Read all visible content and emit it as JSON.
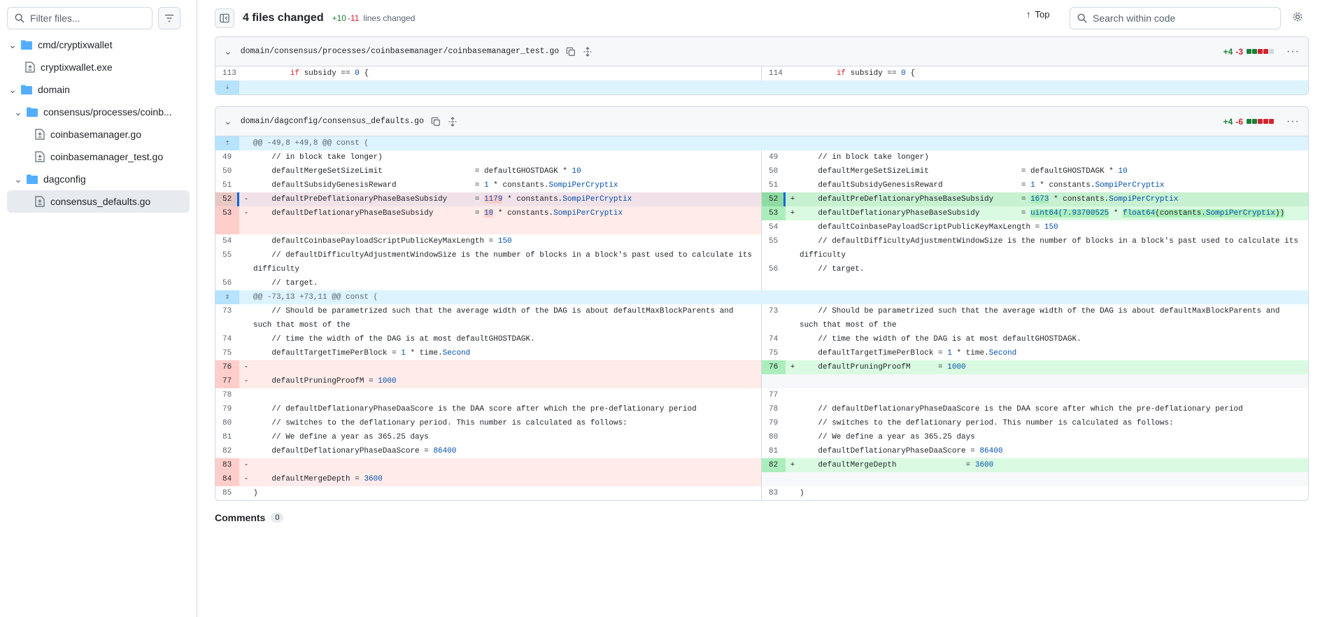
{
  "sidebar": {
    "filter_placeholder": "Filter files...",
    "tree": [
      {
        "label": "cmd/cryptixwallet",
        "type": "folder"
      },
      {
        "label": "cryptixwallet.exe",
        "type": "file"
      },
      {
        "label": "domain",
        "type": "folder"
      },
      {
        "label": "consensus/processes/coinb...",
        "type": "folder"
      },
      {
        "label": "coinbasemanager.go",
        "type": "file"
      },
      {
        "label": "coinbasemanager_test.go",
        "type": "file"
      },
      {
        "label": "dagconfig",
        "type": "folder"
      },
      {
        "label": "consensus_defaults.go",
        "type": "file",
        "selected": true
      }
    ]
  },
  "header": {
    "files_changed": "4 files changed",
    "additions": "+10",
    "deletions": "-11",
    "lines_label": "lines changed",
    "top_label": "Top",
    "search_placeholder": "Search within code"
  },
  "file1": {
    "path": "domain/consensus/processes/coinbasemanager/coinbasemanager_test.go",
    "add": "+4",
    "del": "-3",
    "left_ln": "113",
    "right_ln": "114",
    "code_pre": "        ",
    "code_kw": "if",
    "code_mid": " subsidy == ",
    "code_num": "0",
    "code_post": " {"
  },
  "file2": {
    "path": "domain/dagconfig/consensus_defaults.go",
    "add": "+4",
    "del": "-6",
    "hunk1": "@@ -49,8 +49,8 @@ const (",
    "hunk2": "@@ -73,13 +73,11 @@ const (",
    "l": {
      "n49": "49",
      "n50": "50",
      "n51": "51",
      "n52": "52",
      "n53": "53",
      "n54": "54",
      "n55": "55",
      "n56": "56",
      "n73": "73",
      "n74": "74",
      "n75": "75",
      "n76": "76",
      "n77": "77",
      "n78": "78",
      "n79": "79",
      "n80": "80",
      "n81": "81",
      "n82": "82",
      "n83": "83",
      "n84": "84",
      "n85": "85"
    },
    "r": {
      "n49": "49",
      "n50": "50",
      "n51": "51",
      "n52": "52",
      "n53": "53",
      "n54": "54",
      "n55": "55",
      "n56": "56",
      "n73": "73",
      "n74": "74",
      "n75": "75",
      "n76": "76",
      "n77": "77",
      "n78": "78",
      "n79": "79",
      "n80": "80",
      "n81": "81",
      "n82": "82",
      "n83": "83"
    },
    "c": {
      "block": "    // in block take longer)",
      "merge_name": "    defaultMergeSetSizeLimit                    = defaultGHOSTDAGK ",
      "merge_num": "10",
      "genesis_name": "    defaultSubsidyGenesisReward                 = ",
      "genesis_num": "1",
      "genesis_tail": " constants.",
      "sompi": "SompiPerCryptix",
      "pre_name": "    defaultPreDeflationaryPhaseBaseSubsidy      = ",
      "pre_old": "1179",
      "pre_new": "1673",
      "star_const": " * constants.",
      "defl_name": "    defaultDeflationaryPhaseBaseSubsidy         = ",
      "defl_old": "10",
      "defl_new_a": "uint64(7.93700525",
      "defl_new_b": " * ",
      "defl_new_c": "float64",
      "defl_new_d": "(constants.",
      "defl_new_e": "))",
      "payload_name": "    defaultCoinbasePayloadScriptPublicKeyMaxLength = ",
      "payload_num": "150",
      "diff_comment": "    // defaultDifficultyAdjustmentWindowSize is the number of blocks in a block's past used to calculate its difficulty",
      "target": "    // target.",
      "param": "    // Should be parametrized such that the average width of the DAG is about defaultMaxBlockParents and such that most of the",
      "time_width": "    // time the width of the DAG is at most defaultGHOSTDAGK.",
      "ttpb_name": "    defaultTargetTimePerBlock = ",
      "ttpb_num": "1",
      "ttpb_tail": " * time.",
      "second": "Second",
      "pruning_old": "    defaultPruningProofM = ",
      "pruning_new": "    defaultPruningProofM      = ",
      "pruning_num": "1000",
      "daa_c1": "    // defaultDeflationaryPhaseDaaScore is the DAA score after which the pre-deflationary period",
      "daa_c2": "    // switches to the deflationary period. This number is calculated as follows:",
      "daa_c3": "    // We define a year as 365.25 days",
      "daa_name": "    defaultDeflationaryPhaseDaaScore = ",
      "daa_num": "86400",
      "md_old": "    defaultMergeDepth = ",
      "md_new": "    defaultMergeDepth               = ",
      "md_num": "3600",
      "close": ")",
      "minus": "-",
      "plus": "+",
      "star": "* "
    }
  },
  "comments": {
    "label": "Comments",
    "count": "0"
  }
}
